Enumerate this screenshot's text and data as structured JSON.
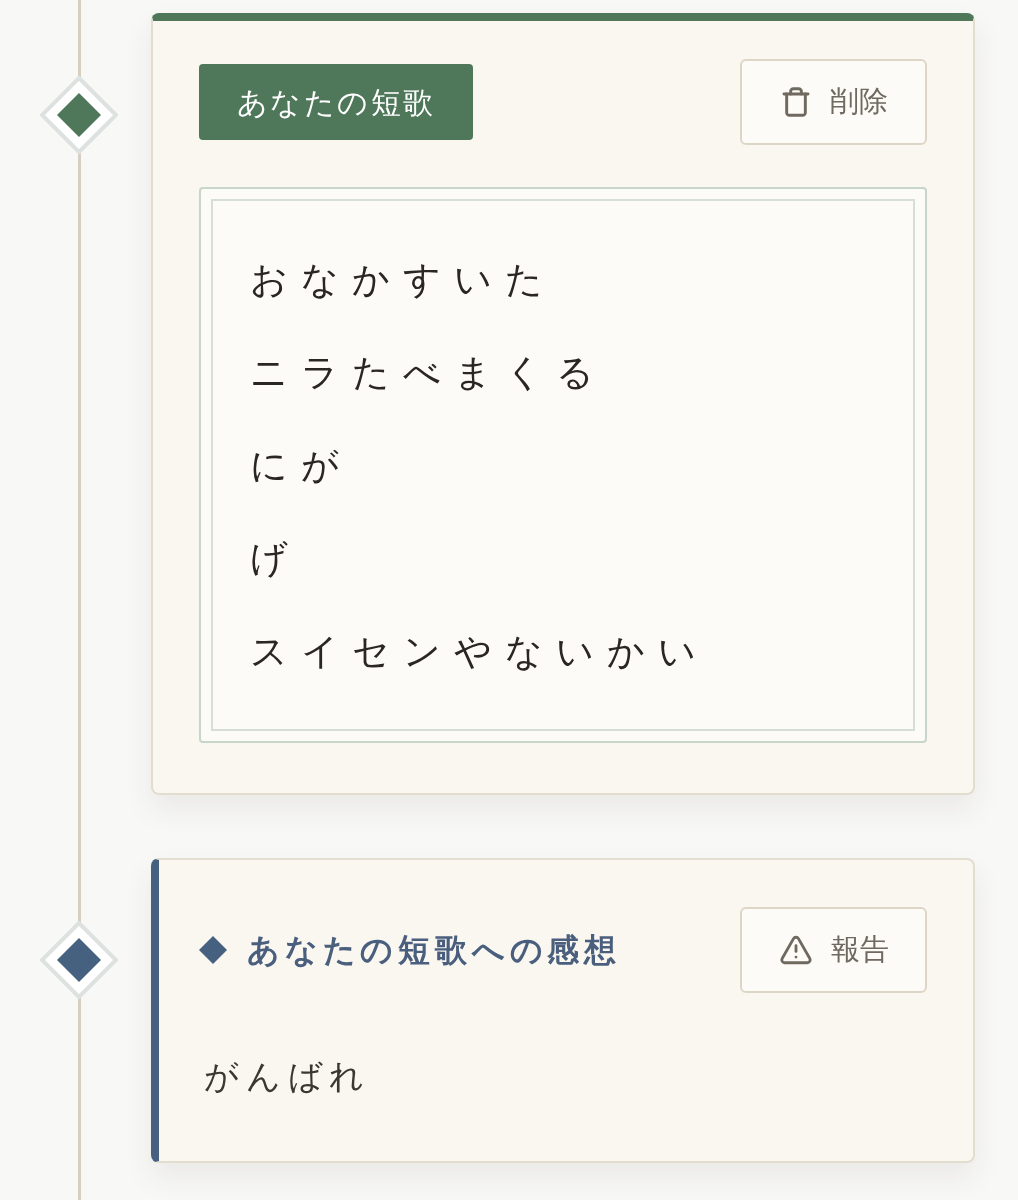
{
  "timeline": [
    {
      "kind": "poem",
      "tag": "あなたの短歌",
      "button": "削除",
      "lines": [
        "おなかすいた",
        "ニラたべまくる",
        "にが",
        "げ",
        "スイセンやないかい"
      ]
    },
    {
      "kind": "comment",
      "heading": "あなたの短歌への感想",
      "button": "報告",
      "text": "がんばれ"
    }
  ]
}
